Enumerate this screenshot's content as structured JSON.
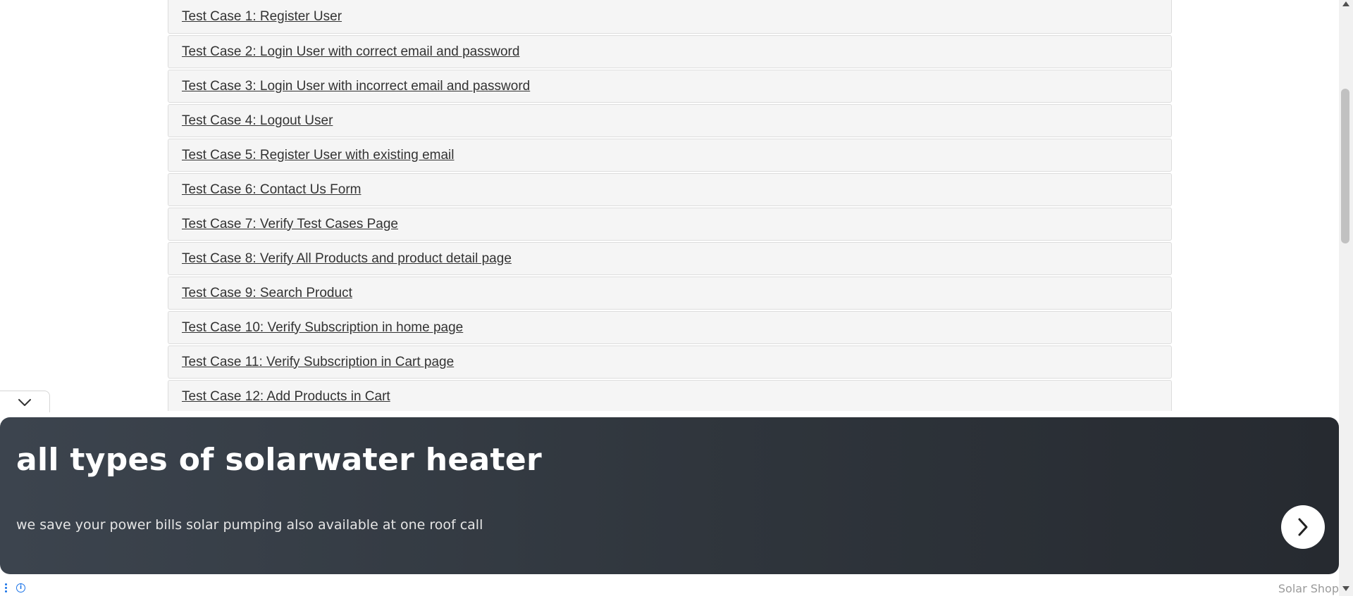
{
  "test_cases": [
    "Test Case 1: Register User",
    "Test Case 2: Login User with correct email and password",
    "Test Case 3: Login User with incorrect email and password",
    "Test Case 4: Logout User",
    "Test Case 5: Register User with existing email",
    "Test Case 6: Contact Us Form",
    "Test Case 7: Verify Test Cases Page",
    "Test Case 8: Verify All Products and product detail page",
    "Test Case 9: Search Product",
    "Test Case 10: Verify Subscription in home page",
    "Test Case 11: Verify Subscription in Cart page",
    "Test Case 12: Add Products in Cart"
  ],
  "ad": {
    "title": "all types of solarwater heater",
    "description": "we save your power bills solar pumping also available at one roof call",
    "brand": "Solar Shop",
    "collapse_icon": "chevron-down-icon",
    "arrow_icon": "chevron-right-icon",
    "info_icon": "info-icon",
    "menu_icon": "vertical-dots-icon"
  },
  "colors": {
    "row_bg": "#f5f5f5",
    "row_border": "#dddddd",
    "link_text": "#333333",
    "ad_bg_start": "#3c444e",
    "ad_bg_end": "#262a30",
    "ad_accent": "#1a73e8"
  }
}
